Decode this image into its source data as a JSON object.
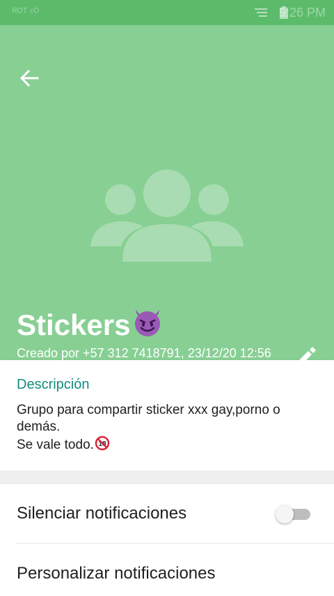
{
  "status_bar": {
    "left_text": "ᴿᴼᵀ ᶜᴼ",
    "time": "9:26 PM",
    "icons": [
      "notification-icon",
      "battery-icon"
    ]
  },
  "colors": {
    "header_bg": "#88cf94",
    "status_bar_bg": "#5bbb6b",
    "accent_teal": "#128c7e",
    "text_dark": "#202020"
  },
  "header": {
    "group_name": "Stickers",
    "group_emoji": "smiling-devil-emoji",
    "created_line": "Creado por +57 312 7418791, 23/12/20 12:56 p. m.",
    "icons": [
      "back-arrow-icon",
      "group-avatar-icon",
      "edit-pencil-icon"
    ]
  },
  "description": {
    "title": "Descripción",
    "line1": "Grupo para compartir sticker xxx gay,porno o demás.",
    "line2": "Se vale todo.",
    "line2_emoji": "no-one-under-eighteen-emoji"
  },
  "settings": {
    "mute_label": "Silenciar notificaciones",
    "mute_enabled": false,
    "custom_label": "Personalizar notificaciones"
  }
}
